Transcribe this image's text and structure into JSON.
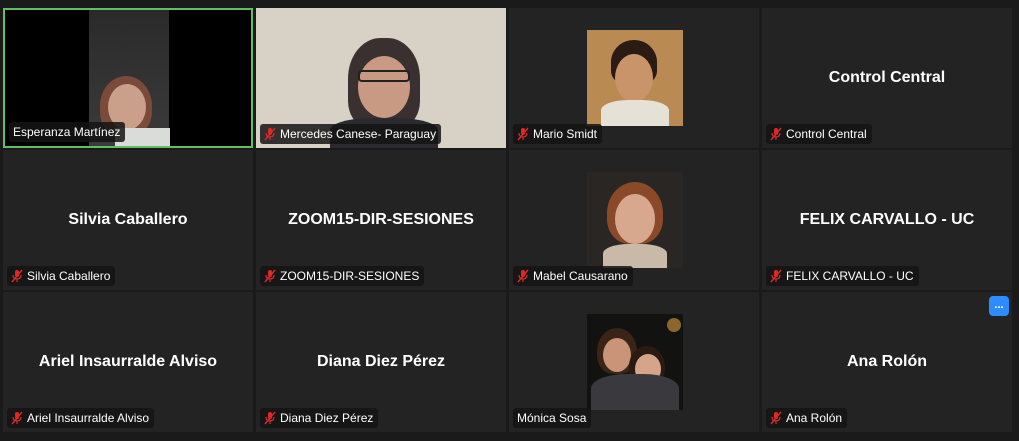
{
  "participants": [
    {
      "name": "Esperanza Martínez",
      "muted": false,
      "type": "video",
      "active": true
    },
    {
      "name": "Mercedes Canese- Paraguay",
      "muted": true,
      "type": "video"
    },
    {
      "name": "Mario Smidt",
      "muted": true,
      "type": "photo"
    },
    {
      "name": "Control Central",
      "muted": true,
      "type": "name"
    },
    {
      "name": "Silvia Caballero",
      "muted": true,
      "type": "name"
    },
    {
      "name": "ZOOM15-DIR-SESIONES",
      "muted": true,
      "type": "name"
    },
    {
      "name": "Mabel Causarano",
      "muted": true,
      "type": "photo"
    },
    {
      "name": "FELIX CARVALLO - UC",
      "muted": true,
      "type": "name"
    },
    {
      "name": "Ariel Insaurralde Alviso",
      "muted": true,
      "type": "name"
    },
    {
      "name": "Diana Diez Pérez",
      "muted": true,
      "type": "name"
    },
    {
      "name": "Mónica Sosa",
      "muted": false,
      "type": "photo"
    },
    {
      "name": "Ana Rolón",
      "muted": true,
      "type": "name"
    }
  ],
  "more_button": {
    "label": "..."
  },
  "colors": {
    "active_border": "#5fbf64",
    "muted_icon": "#e02828",
    "accent": "#2d8cff"
  }
}
